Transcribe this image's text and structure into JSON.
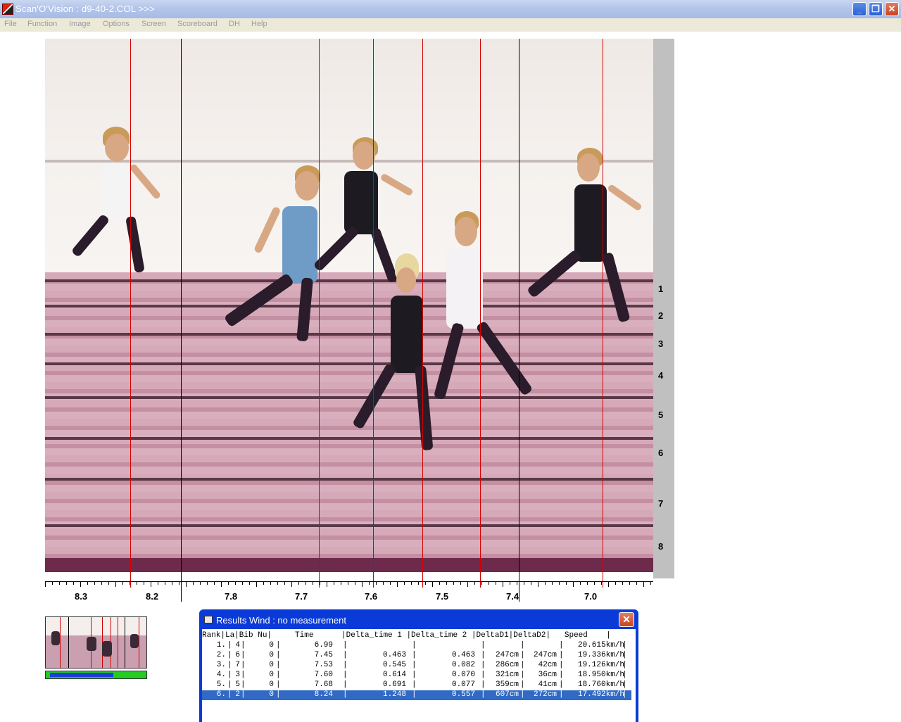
{
  "window": {
    "title": "Scan'O'Vision :  d9-40-2.COL  >>>"
  },
  "window_buttons": {
    "minimize": "_",
    "maximize": "❐",
    "close": "✕"
  },
  "menu": [
    "File",
    "Function",
    "Image",
    "Options",
    "Screen",
    "Scoreboard",
    "DH",
    "Help"
  ],
  "lanes": [
    "1",
    "2",
    "3",
    "4",
    "5",
    "6",
    "7",
    "8"
  ],
  "scale_labels": [
    "8.3",
    "8.2",
    "7.8",
    "7.7",
    "7.6",
    "7.5",
    "7.4",
    "7.0"
  ],
  "results": {
    "title": "Results   Wind : no measurement",
    "close": "✕",
    "header": "Rank|La|Bib Nu|     Time      |Delta_time 1 |Delta_time 2 |DeltaD1|DeltaD2|   Speed    |",
    "rows": [
      {
        "rank": "1.",
        "lane": "4",
        "bib": "0",
        "time": "6.99",
        "dt1": "",
        "dt2": "",
        "dd1": "",
        "dd2": "",
        "speed": "20.615km/h"
      },
      {
        "rank": "2.",
        "lane": "6",
        "bib": "0",
        "time": "7.45",
        "dt1": "0.463",
        "dt2": "0.463",
        "dd1": "247cm",
        "dd2": "247cm",
        "speed": "19.336km/h"
      },
      {
        "rank": "3.",
        "lane": "7",
        "bib": "0",
        "time": "7.53",
        "dt1": "0.545",
        "dt2": "0.082",
        "dd1": "286cm",
        "dd2": "42cm",
        "speed": "19.126km/h"
      },
      {
        "rank": "4.",
        "lane": "3",
        "bib": "0",
        "time": "7.60",
        "dt1": "0.614",
        "dt2": "0.070",
        "dd1": "321cm",
        "dd2": "36cm",
        "speed": "18.950km/h"
      },
      {
        "rank": "5.",
        "lane": "5",
        "bib": "0",
        "time": "7.68",
        "dt1": "0.691",
        "dt2": "0.077",
        "dd1": "359cm",
        "dd2": "41cm",
        "speed": "18.760km/h"
      },
      {
        "rank": "6.",
        "lane": "2",
        "bib": "0",
        "time": "8.24",
        "dt1": "1.248",
        "dt2": "0.557",
        "dd1": "607cm",
        "dd2": "272cm",
        "speed": "17.492km/h"
      }
    ],
    "selected_row": 5
  }
}
